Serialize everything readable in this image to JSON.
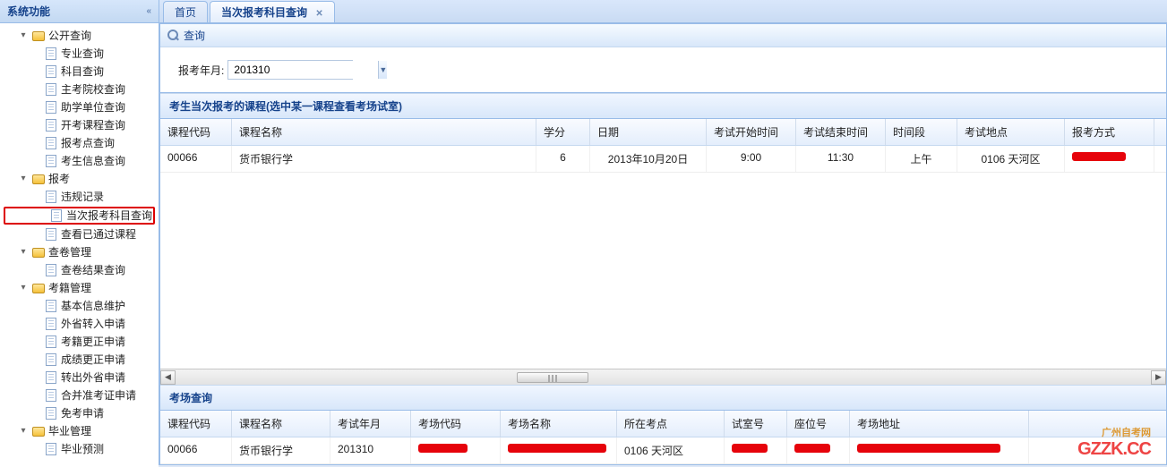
{
  "sidebar": {
    "title": "系统功能",
    "groups": [
      {
        "label": "公开查询",
        "expanded": true,
        "items": [
          {
            "label": "专业查询"
          },
          {
            "label": "科目查询"
          },
          {
            "label": "主考院校查询"
          },
          {
            "label": "助学单位查询"
          },
          {
            "label": "开考课程查询"
          },
          {
            "label": "报考点查询"
          },
          {
            "label": "考生信息查询"
          }
        ]
      },
      {
        "label": "报考",
        "expanded": true,
        "items": [
          {
            "label": "违规记录"
          },
          {
            "label": "当次报考科目查询",
            "highlight": true
          },
          {
            "label": "查看已通过课程"
          }
        ]
      },
      {
        "label": "查卷管理",
        "expanded": true,
        "items": [
          {
            "label": "查卷结果查询"
          }
        ]
      },
      {
        "label": "考籍管理",
        "expanded": true,
        "items": [
          {
            "label": "基本信息维护"
          },
          {
            "label": "外省转入申请"
          },
          {
            "label": "考籍更正申请"
          },
          {
            "label": "成绩更正申请"
          },
          {
            "label": "转出外省申请"
          },
          {
            "label": "合并准考证申请"
          },
          {
            "label": "免考申请"
          }
        ]
      },
      {
        "label": "毕业管理",
        "expanded": true,
        "items": [
          {
            "label": "毕业预测"
          }
        ]
      }
    ]
  },
  "tabs": [
    {
      "label": "首页",
      "closable": false
    },
    {
      "label": "当次报考科目查询",
      "closable": true,
      "active": true
    }
  ],
  "query": {
    "title": "查询",
    "field_label": "报考年月:",
    "value": "201310"
  },
  "panel1": {
    "title": "考生当次报考的课程(选中某一课程查看考场试室)",
    "headers": [
      "课程代码",
      "课程名称",
      "学分",
      "日期",
      "考试开始时间",
      "考试结束时间",
      "时间段",
      "考试地点",
      "报考方式"
    ],
    "row": {
      "code": "00066",
      "name": "货币银行学",
      "credit": "6",
      "date": "2013年10月20日",
      "start": "9:00",
      "end": "11:30",
      "slot": "上午",
      "place": "0106 天河区",
      "mode": "[redacted]"
    }
  },
  "panel2": {
    "title": "考场查询",
    "headers": [
      "课程代码",
      "课程名称",
      "考试年月",
      "考场代码",
      "考场名称",
      "所在考点",
      "试室号",
      "座位号",
      "考场地址"
    ],
    "row": {
      "code": "00066",
      "name": "货币银行学",
      "ym": "201310",
      "venue_code": "[redacted]",
      "venue_name": "[redacted]",
      "location": "0106 天河区",
      "room": "[redacted]",
      "seat": "[redacted]",
      "addr": "[redacted]"
    }
  },
  "watermark": {
    "line1": "广州自考网",
    "line2": "GZZK",
    "line3": ".CC"
  }
}
